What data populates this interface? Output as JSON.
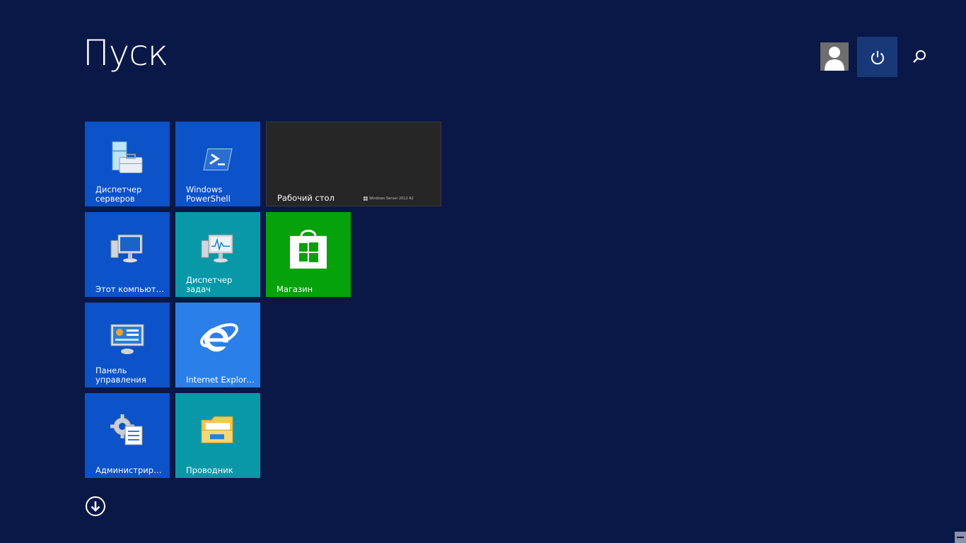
{
  "header": {
    "title": "Пуск"
  },
  "colors": {
    "background": "#0a1847",
    "tile_blue": "#0c52c9",
    "tile_teal": "#0898a8",
    "tile_dark": "#262626",
    "tile_green": "#06a20b",
    "tile_ie": "#2b7fea",
    "power_bg": "#183878"
  },
  "top_bar": {
    "avatar_icon": "user-avatar-icon",
    "power_icon": "power-icon",
    "search_icon": "search-icon"
  },
  "tiles": {
    "server_manager": {
      "label": "Диспетчер\nсерверов",
      "icon": "server-manager-icon"
    },
    "powershell": {
      "label": "Windows\nPowerShell",
      "icon": "powershell-icon"
    },
    "desktop": {
      "label": "Рабочий стол",
      "watermark": "Windows Server 2012 R2"
    },
    "this_pc": {
      "label": "Этот компьютер",
      "icon": "computer-icon"
    },
    "task_manager": {
      "label": "Диспетчер\nзадач",
      "icon": "task-manager-icon"
    },
    "store": {
      "label": "Магазин",
      "icon": "store-icon"
    },
    "control_panel": {
      "label": "Панель\nуправления",
      "icon": "control-panel-icon"
    },
    "ie": {
      "label": "Internet Explorer",
      "icon": "internet-explorer-icon"
    },
    "admin_tools": {
      "label": "Администриро...",
      "icon": "admin-tools-icon"
    },
    "explorer": {
      "label": "Проводник",
      "icon": "file-explorer-icon"
    }
  },
  "footer": {
    "apps_icon": "down-arrow-circle-icon"
  }
}
